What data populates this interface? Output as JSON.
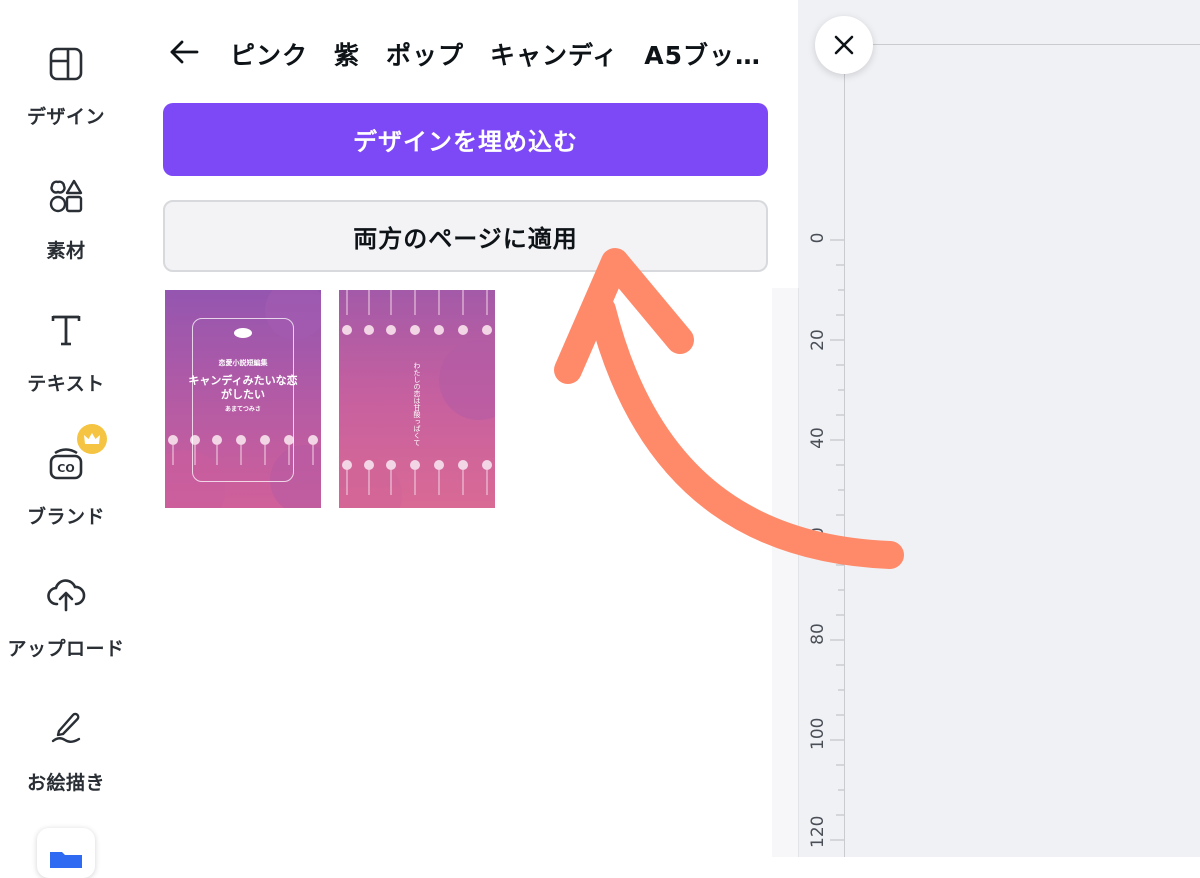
{
  "sidebar": {
    "items": [
      {
        "label": "デザイン",
        "icon": "layout-icon"
      },
      {
        "label": "素材",
        "icon": "shapes-icon"
      },
      {
        "label": "テキスト",
        "icon": "text-icon"
      },
      {
        "label": "ブランド",
        "icon": "brand-icon"
      },
      {
        "label": "アップロード",
        "icon": "cloud-upload-icon"
      },
      {
        "label": "お絵描き",
        "icon": "draw-icon"
      }
    ]
  },
  "panel": {
    "back_icon": "arrow-left-icon",
    "title": "ピンク　紫　ポップ　キャンディ　A5ブッ…",
    "embed_button": "デザインを埋め込む",
    "apply_button": "両方のページに適用",
    "thumbnails": [
      {
        "line1": "恋愛小説短編集",
        "line2": "キャンディみたいな恋",
        "line3": "がしたい",
        "line4": "あまてつみさ"
      },
      {
        "vertical_text": "わたしの恋は甘酸っぱくて"
      }
    ]
  },
  "canvas": {
    "close_icon": "close-icon",
    "ruler_ticks": [
      "0",
      "20",
      "40",
      "60",
      "80",
      "100",
      "120"
    ]
  },
  "colors": {
    "accent": "#7d48f5",
    "annotation_arrow": "#ff8a6a",
    "canvas_bg": "#f0f1f5",
    "premium_crown": "#f5c443"
  }
}
